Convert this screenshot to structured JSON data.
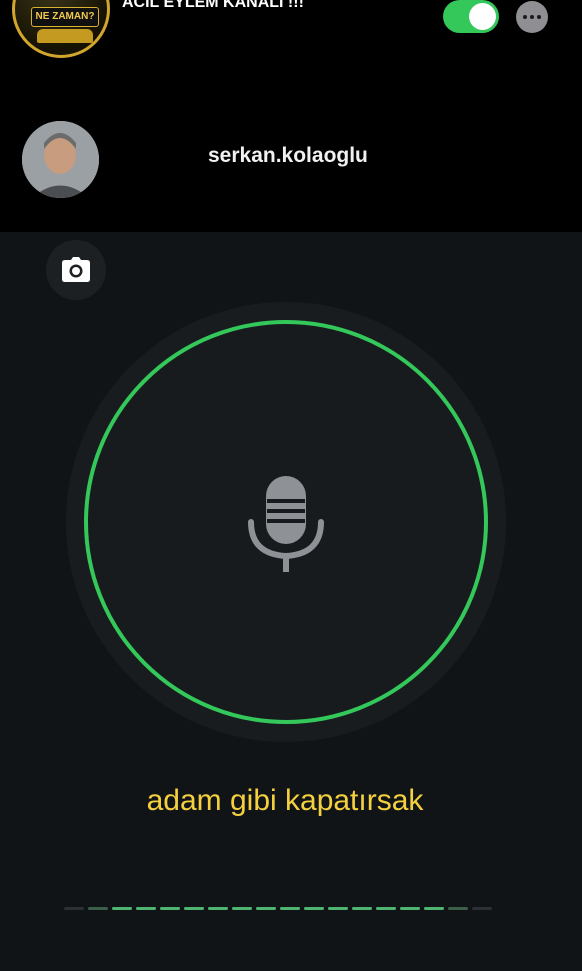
{
  "header": {
    "channel_avatar_text": "NE ZAMAN?",
    "channel_title": "ACİL EYLEM KANALI !!!",
    "toggle_on": true,
    "more_icon": "ellipsis-icon"
  },
  "user": {
    "username": "serkan.kolaoglu"
  },
  "controls": {
    "camera_icon": "camera-icon",
    "mic_icon": "microphone-icon"
  },
  "transcript": {
    "text": "adam gibi kapatırsak"
  },
  "colors": {
    "accent_green": "#34c759",
    "transcript_yellow": "#f4d03f",
    "background": "#111416"
  }
}
